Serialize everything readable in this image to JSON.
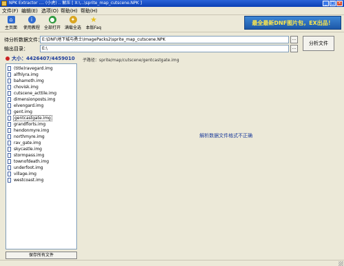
{
  "window": {
    "title": "NPK Extractor .... (小虎) .. 解压 [ X:\\...\\sprite_map_cutscene.NPK ]"
  },
  "menu": [
    {
      "label": "文件(F)"
    },
    {
      "label": "编辑(E)"
    },
    {
      "label": "选项(O)"
    },
    {
      "label": "帮助(H)"
    },
    {
      "label": "帮助(H)"
    }
  ],
  "toolbar": [
    {
      "label": "主页面",
      "icon": "home-icon",
      "color": "#2f6bd0"
    },
    {
      "label": "使用教程",
      "icon": "info-icon",
      "color": "#2f6bd0"
    },
    {
      "label": "全部打开",
      "icon": "globe-icon",
      "color": "#2f9a3f"
    },
    {
      "label": "满载全选",
      "icon": "lightbulb-icon",
      "color": "#d9a520"
    },
    {
      "label": "本版Faq",
      "icon": "star-icon",
      "color": "#e8c020"
    }
  ],
  "banner": {
    "text": "最全最新DNF图片包，EX出品！"
  },
  "source": {
    "label": "待分析数据文件：",
    "value": "E:\\DNF\\地下城与勇士\\ImagePacks2\\sprite_map_cutscene.NPK"
  },
  "output": {
    "label": "输出目录：",
    "value": "E:\\"
  },
  "browse_label": "...",
  "analyze_label": "分析文件",
  "size_text": "大小：4426407/4459010",
  "subpath": "子路径：sprite/map/cutscene/gentcastgate.img",
  "files": [
    {
      "name": "(title)ravegard.img",
      "selected": false
    },
    {
      "name": "alfhlyra.img",
      "selected": false
    },
    {
      "name": "bahamoth.img",
      "selected": false
    },
    {
      "name": "chovisk.img",
      "selected": false
    },
    {
      "name": "cutscene_acttile.img",
      "selected": false
    },
    {
      "name": "dimensionposts.img",
      "selected": false
    },
    {
      "name": "elvengard.img",
      "selected": false
    },
    {
      "name": "gent.img",
      "selected": false
    },
    {
      "name": "gentcastgate.img",
      "selected": true
    },
    {
      "name": "grandflorts.img",
      "selected": false
    },
    {
      "name": "hendonmyre.img",
      "selected": false
    },
    {
      "name": "northmyre.img",
      "selected": false
    },
    {
      "name": "rav_gate.img",
      "selected": false
    },
    {
      "name": "skycastle.img",
      "selected": false
    },
    {
      "name": "stormpass.img",
      "selected": false
    },
    {
      "name": "townofdeath.img",
      "selected": false
    },
    {
      "name": "underfoot.img",
      "selected": false
    },
    {
      "name": "village.img",
      "selected": false
    },
    {
      "name": "westcoast.img",
      "selected": false
    }
  ],
  "save_label": "保存所有文件",
  "error_message": "解析数据文件格式不正确"
}
